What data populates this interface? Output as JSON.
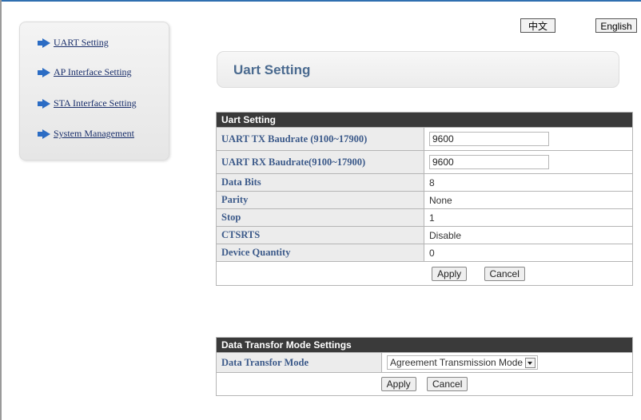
{
  "sidebar": {
    "items": [
      {
        "label": "UART Setting"
      },
      {
        "label": "AP Interface Setting"
      },
      {
        "label": "STA Interface Setting"
      },
      {
        "label": "System Management"
      }
    ]
  },
  "language": {
    "chinese": "中文",
    "english": "English"
  },
  "page_title": "Uart Setting",
  "uart_section": {
    "header": "Uart Setting",
    "tx_label": "UART TX Baudrate (9100~17900)",
    "tx_value": "9600",
    "rx_label": "UART RX Baudrate(9100~17900)",
    "rx_value": "9600",
    "rows": [
      {
        "label": "Data Bits",
        "value": "8"
      },
      {
        "label": "Parity",
        "value": "None"
      },
      {
        "label": "Stop",
        "value": "1"
      },
      {
        "label": "CTSRTS",
        "value": "Disable"
      },
      {
        "label": "Device Quantity",
        "value": "0"
      }
    ],
    "apply": "Apply",
    "cancel": "Cancel"
  },
  "mode_section": {
    "header": "Data Transfor Mode Settings",
    "mode_label": "Data Transfor Mode",
    "mode_value": "Agreement Transmission Mode",
    "apply": "Apply",
    "cancel": "Cancel"
  }
}
